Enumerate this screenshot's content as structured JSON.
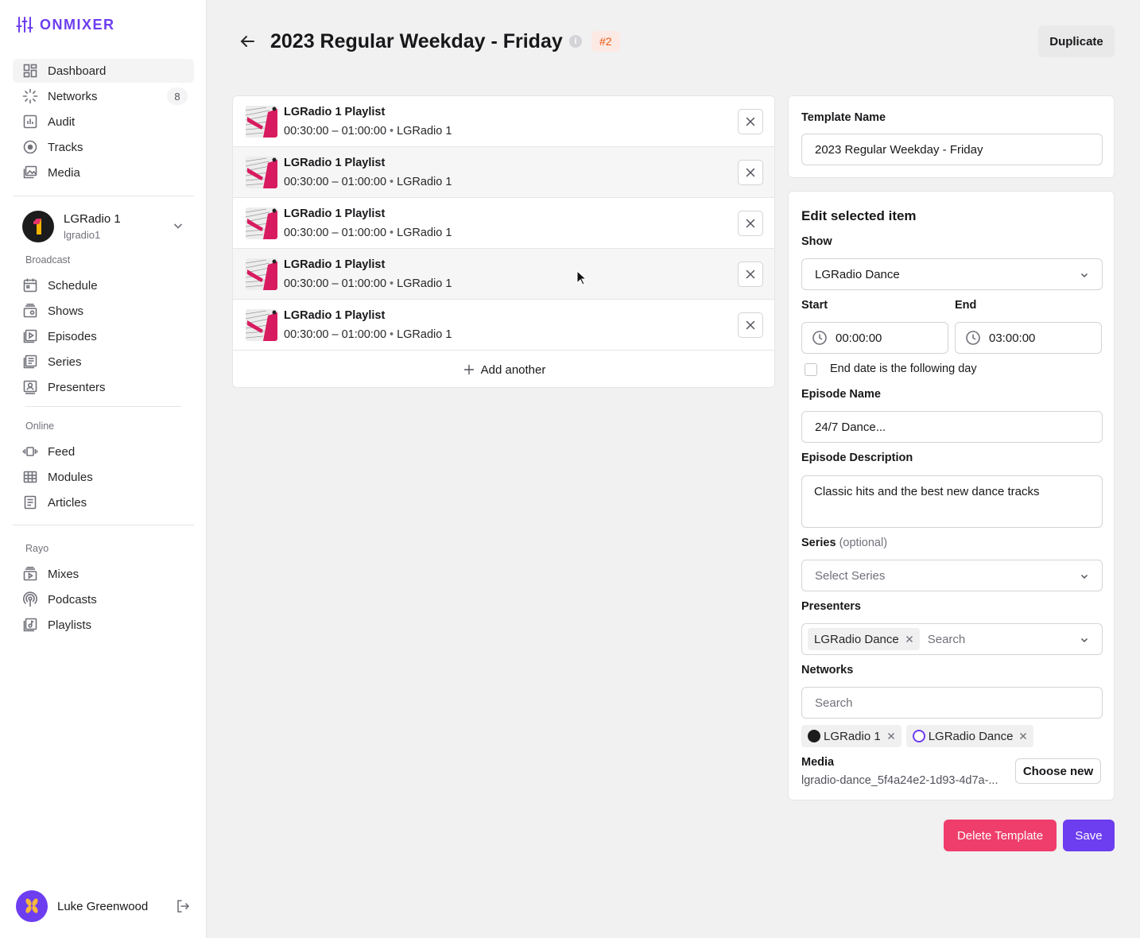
{
  "app": {
    "logo_text": "ONMIXER"
  },
  "sidebar": {
    "main_items": [
      {
        "label": "Dashboard",
        "icon": "dashboard-icon"
      },
      {
        "label": "Networks",
        "icon": "networks-icon",
        "badge": "8"
      },
      {
        "label": "Audit",
        "icon": "audit-icon"
      },
      {
        "label": "Tracks",
        "icon": "tracks-icon"
      },
      {
        "label": "Media",
        "icon": "media-icon"
      }
    ],
    "station": {
      "name": "LGRadio 1",
      "handle": "lgradio1"
    },
    "broadcast": {
      "label": "Broadcast",
      "items": [
        {
          "label": "Schedule",
          "icon": "calendar-icon"
        },
        {
          "label": "Shows",
          "icon": "shows-icon"
        },
        {
          "label": "Episodes",
          "icon": "episodes-icon"
        },
        {
          "label": "Series",
          "icon": "series-icon"
        },
        {
          "label": "Presenters",
          "icon": "presenters-icon"
        }
      ]
    },
    "online": {
      "label": "Online",
      "items": [
        {
          "label": "Feed",
          "icon": "feed-icon"
        },
        {
          "label": "Modules",
          "icon": "modules-icon"
        },
        {
          "label": "Articles",
          "icon": "articles-icon"
        }
      ]
    },
    "rayo": {
      "label": "Rayo",
      "items": [
        {
          "label": "Mixes",
          "icon": "mixes-icon"
        },
        {
          "label": "Podcasts",
          "icon": "podcasts-icon"
        },
        {
          "label": "Playlists",
          "icon": "playlists-icon"
        }
      ]
    },
    "user": {
      "name": "Luke Greenwood"
    }
  },
  "header": {
    "title": "2023 Regular Weekday - Friday",
    "info": "i",
    "tag": "#2",
    "duplicate_label": "Duplicate"
  },
  "schedule_items": [
    {
      "title": "LGRadio 1 Playlist",
      "time": "00:30:00 – 01:00:00",
      "sep": "•",
      "network": "LGRadio 1"
    },
    {
      "title": "LGRadio 1 Playlist",
      "time": "00:30:00 – 01:00:00",
      "sep": "•",
      "network": "LGRadio 1"
    },
    {
      "title": "LGRadio 1 Playlist",
      "time": "00:30:00 – 01:00:00",
      "sep": "•",
      "network": "LGRadio 1"
    },
    {
      "title": "LGRadio 1 Playlist",
      "time": "00:30:00 – 01:00:00",
      "sep": "•",
      "network": "LGRadio 1"
    },
    {
      "title": "LGRadio 1 Playlist",
      "time": "00:30:00 – 01:00:00",
      "sep": "•",
      "network": "LGRadio 1"
    }
  ],
  "add_another_label": "Add another",
  "template": {
    "name_label": "Template Name",
    "name_value": "2023 Regular Weekday - Friday"
  },
  "edit": {
    "title": "Edit selected item",
    "show_label": "Show",
    "show_value": "LGRadio Dance",
    "start_label": "Start",
    "start_value": "00:00:00",
    "end_label": "End",
    "end_value": "03:00:00",
    "end_next_day_label": "End date is the following day",
    "end_next_day_checked": false,
    "episode_name_label": "Episode Name",
    "episode_name_value": "24/7 Dance...",
    "episode_desc_label": "Episode Description",
    "episode_desc_value": "Classic hits and the best new dance tracks",
    "series_label": "Series",
    "series_optional": "(optional)",
    "series_placeholder": "Select Series",
    "presenters_label": "Presenters",
    "presenters_chip": "LGRadio Dance",
    "presenters_placeholder": "Search",
    "networks_label": "Networks",
    "networks_placeholder": "Search",
    "network_chips": [
      {
        "label": "LGRadio 1"
      },
      {
        "label": "LGRadio Dance"
      }
    ],
    "media_label": "Media",
    "media_file": "lgradio-dance_5f4a24e2-1d93-4d7a-...",
    "choose_new_label": "Choose new"
  },
  "actions": {
    "delete_label": "Delete Template",
    "save_label": "Save"
  },
  "colors": {
    "accent": "#6d3df0",
    "danger": "#ef3e6b",
    "tag_text": "#ea580c",
    "tag_bg": "#fde9e4"
  }
}
